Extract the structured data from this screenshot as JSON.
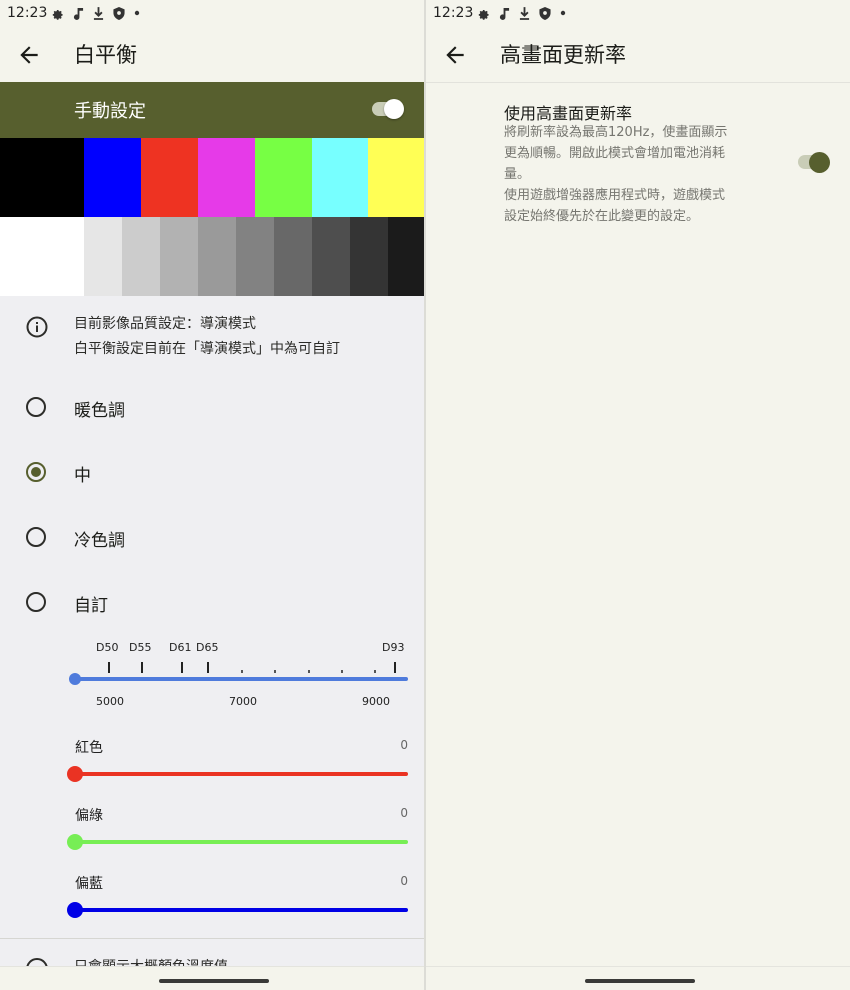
{
  "status_bar": {
    "time": "12:23",
    "icons": [
      "gear-icon",
      "music-note-icon",
      "download-icon",
      "shield-icon",
      "dot-icon"
    ]
  },
  "left": {
    "title": "白平衡",
    "manual_setting": {
      "label": "手動設定",
      "enabled": true
    },
    "color_bars": [
      "#000000",
      "#0000ff",
      "#ee3322",
      "#e63ae8",
      "#77ff44",
      "#77ffff",
      "#ffff55"
    ],
    "gray_bars": [
      "#ffffff",
      "#e6e6e6",
      "#cccccc",
      "#b2b2b2",
      "#9a9a9a",
      "#828282",
      "#686868",
      "#4e4e4e",
      "#343434",
      "#1b1b1b"
    ],
    "info": {
      "line1": "目前影像品質設定：導演模式",
      "line2": "白平衡設定目前在「導演模式」中為可自訂"
    },
    "options": [
      {
        "label": "暖色調",
        "checked": false
      },
      {
        "label": "中",
        "checked": true
      },
      {
        "label": "冷色調",
        "checked": false
      },
      {
        "label": "自訂",
        "checked": false
      }
    ],
    "temperature": {
      "markers": [
        "D50",
        "D55",
        "D61",
        "D65",
        "D93"
      ],
      "scale": [
        "5000",
        "7000",
        "9000"
      ],
      "value": 4500
    },
    "sliders": [
      {
        "label": "紅色",
        "value": "0",
        "color": "#ea3323"
      },
      {
        "label": "偏綠",
        "value": "0",
        "color": "#77ee55"
      },
      {
        "label": "偏藍",
        "value": "0",
        "color": "#0000e6"
      }
    ],
    "bottom_partial": "只會顯示大概顏色溫度值"
  },
  "right": {
    "title": "高畫面更新率",
    "setting": {
      "title": "使用高畫面更新率",
      "desc1": "將刷新率設為最高120Hz，使畫面顯示",
      "desc2": "更為順暢。開啟此模式會增加電池消耗",
      "desc3": "量。",
      "desc4": "使用遊戲增強器應用程式時，遊戲模式",
      "desc5": "設定始終優先於在此變更的設定。",
      "enabled": true
    }
  },
  "colors": {
    "accent": "#575f2e",
    "temp_slider": "#4f7bdc"
  }
}
